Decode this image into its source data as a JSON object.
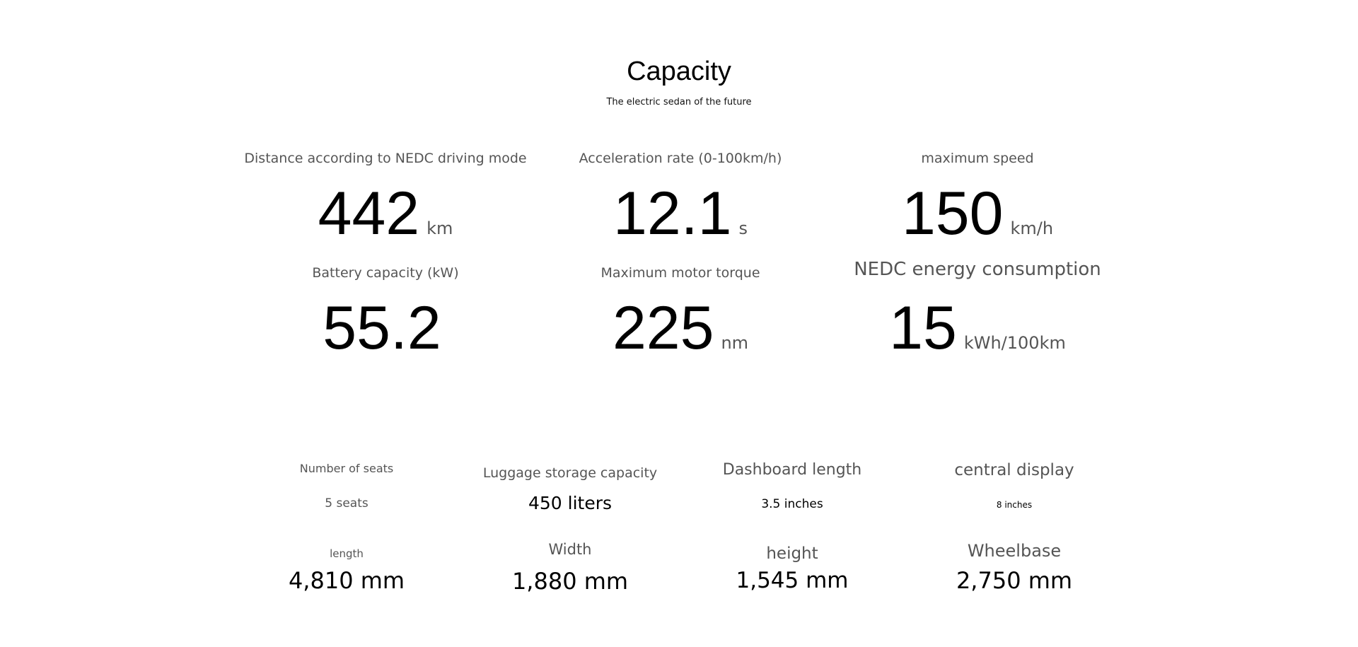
{
  "header": {
    "title": "Capacity",
    "subtitle": "The electric sedan of the future"
  },
  "stats": [
    {
      "label": "Distance according to NEDC driving mode",
      "value": "442",
      "unit": "km"
    },
    {
      "label": "Acceleration rate (0-100km/h)",
      "value": "12.1",
      "unit": "s"
    },
    {
      "label": "maximum speed",
      "value": "150",
      "unit": "km/h"
    },
    {
      "label": "Battery capacity (kW)",
      "value": "55.2",
      "unit": ""
    },
    {
      "label": "Maximum motor torque",
      "value": "225",
      "unit": "nm"
    },
    {
      "label": "NEDC energy consumption",
      "value": "15",
      "unit": "kWh/100km"
    }
  ],
  "specs": [
    {
      "label": "Number of seats",
      "value": "5 seats"
    },
    {
      "label": "Luggage storage capacity",
      "value": "450 liters"
    },
    {
      "label": "Dashboard length",
      "value": "3.5 inches"
    },
    {
      "label": "central display",
      "value": "8 inches"
    },
    {
      "label": "length",
      "value": "4,810 mm"
    },
    {
      "label": "Width",
      "value": "1,880 mm"
    },
    {
      "label": "height",
      "value": "1,545 mm"
    },
    {
      "label": "Wheelbase",
      "value": "2,750 mm"
    }
  ]
}
